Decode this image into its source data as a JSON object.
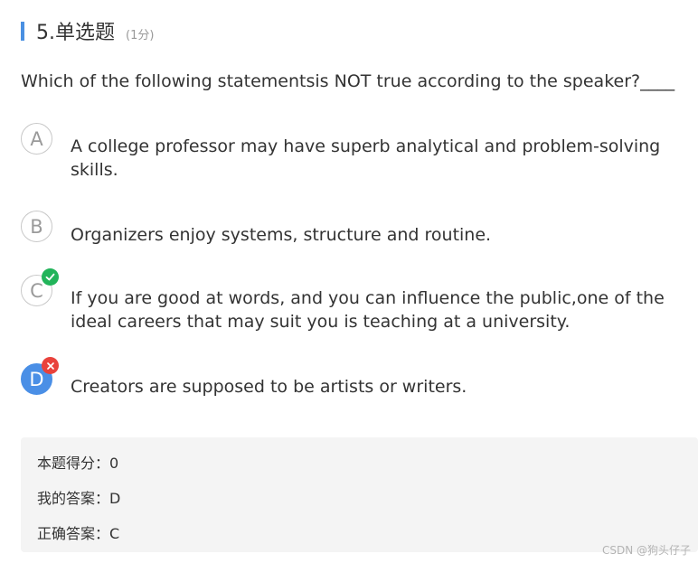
{
  "question": {
    "title": "5.单选题",
    "score": "(1分)",
    "stem": "Which of the following statementsis NOT true according to the speaker?____"
  },
  "options": [
    {
      "letter": "A",
      "text": "A college professor may have superb analytical and problem-solving skills.",
      "status": "none"
    },
    {
      "letter": "B",
      "text": "Organizers enjoy systems, structure and routine.",
      "status": "none"
    },
    {
      "letter": "C",
      "text": "If you are good at words, and you can influence the public,one of the ideal careers that may suit you is teaching at a university.",
      "status": "correct"
    },
    {
      "letter": "D",
      "text": "Creators are supposed to be artists or writers.",
      "status": "selected-wrong"
    }
  ],
  "result": {
    "score_line": "本题得分：0",
    "my_answer_line": "我的答案：D",
    "correct_answer_line": "正确答案：C"
  },
  "watermark": "CSDN @狗头仔子",
  "colors": {
    "accent_bar": "#4a90e2",
    "selected_option": "#4a8fe6",
    "correct_badge": "#22b45a",
    "wrong_badge": "#e9423c"
  },
  "icons": {
    "correct_badge": "check-icon",
    "wrong_badge": "cross-icon"
  }
}
